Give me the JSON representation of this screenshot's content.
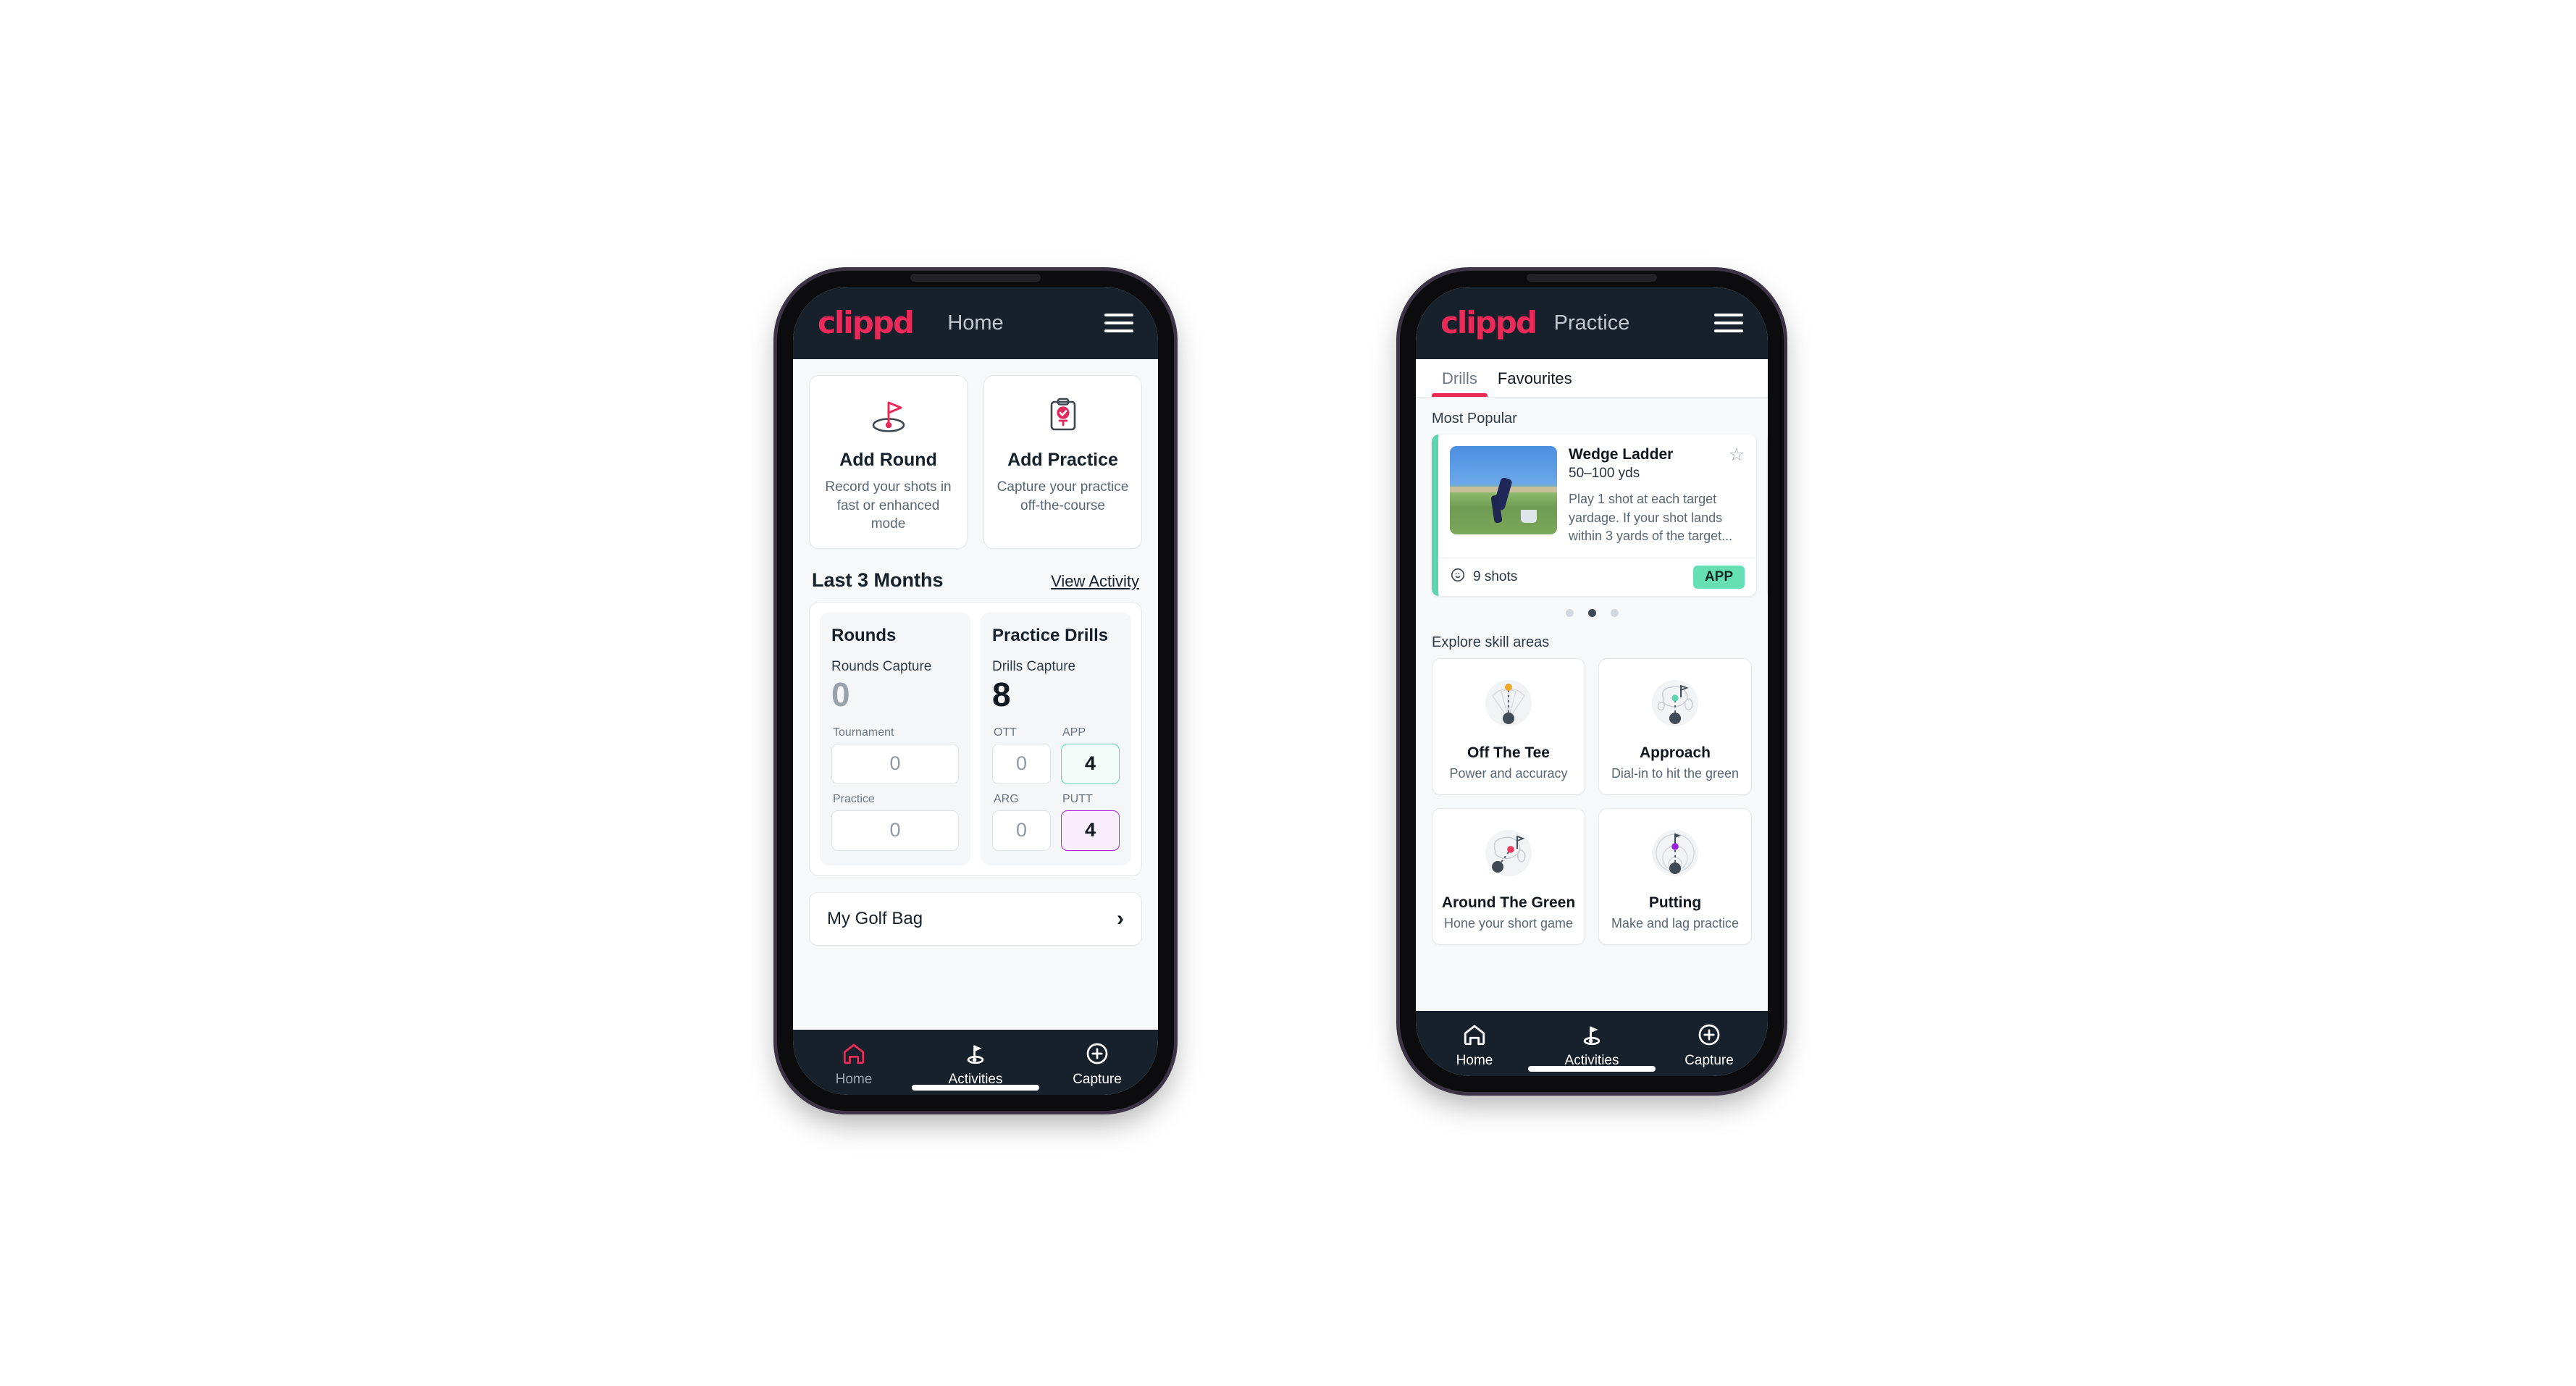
{
  "phone_home": {
    "appbar": {
      "logo": "clippd",
      "title": "Home",
      "menu_icon": "hamburger-menu-icon"
    },
    "actions": [
      {
        "icon": "golf-flag-icon",
        "title": "Add Round",
        "subtitle": "Record your shots in fast or enhanced mode"
      },
      {
        "icon": "clipboard-check-icon",
        "title": "Add Practice",
        "subtitle": "Capture your practice off-the-course"
      }
    ],
    "section": {
      "title": "Last 3 Months",
      "link": "View Activity"
    },
    "rounds": {
      "heading": "Rounds",
      "capture_label": "Rounds Capture",
      "capture_value": "0",
      "items": [
        {
          "label": "Tournament",
          "value": "0"
        },
        {
          "label": "Practice",
          "value": "0"
        }
      ]
    },
    "drills": {
      "heading": "Practice Drills",
      "capture_label": "Drills Capture",
      "capture_value": "8",
      "items": [
        {
          "label": "OTT",
          "value": "0",
          "style": "plain"
        },
        {
          "label": "APP",
          "value": "4",
          "style": "app"
        },
        {
          "label": "ARG",
          "value": "0",
          "style": "plain"
        },
        {
          "label": "PUTT",
          "value": "4",
          "style": "putt"
        }
      ]
    },
    "golf_bag": {
      "label": "My Golf Bag",
      "chevron": "chevron-right-icon"
    },
    "bottom_nav": [
      {
        "icon": "home-icon",
        "label": "Home",
        "state": "active-pink"
      },
      {
        "icon": "golf-flag-nav-icon",
        "label": "Activities",
        "state": "active-white"
      },
      {
        "icon": "plus-circle-icon",
        "label": "Capture",
        "state": "active-white"
      }
    ]
  },
  "phone_practice": {
    "appbar": {
      "logo": "clippd",
      "title": "Practice",
      "menu_icon": "hamburger-menu-icon"
    },
    "tabs": [
      {
        "label": "Drills",
        "selected": true
      },
      {
        "label": "Favourites",
        "selected": false
      }
    ],
    "most_popular_label": "Most Popular",
    "drill": {
      "thumbnail": "golfer-wedge-photo",
      "name": "Wedge Ladder",
      "yardage": "50–100 yds",
      "description": "Play 1 shot at each target yardage. If your shot lands within 3 yards of the target...",
      "star_icon": "star-outline-icon",
      "shots_icon": "golf-ball-icon",
      "shots": "9 shots",
      "badge": "APP",
      "accent_color": "#5fd4b0",
      "next_accent_color": "#9b1fe0"
    },
    "carousel_dots": {
      "count": 3,
      "active_index": 1
    },
    "explore_label": "Explore skill areas",
    "skills": [
      {
        "icon": "off-the-tee-icon",
        "title": "Off The Tee",
        "subtitle": "Power and accuracy",
        "dot_color": "#f0a82a"
      },
      {
        "icon": "approach-icon",
        "title": "Approach",
        "subtitle": "Dial-in to hit the green",
        "dot_color": "#5fd4b0"
      },
      {
        "icon": "around-the-green-icon",
        "title": "Around The Green",
        "subtitle": "Hone your short game",
        "dot_color": "#ec3b5e"
      },
      {
        "icon": "putting-icon",
        "title": "Putting",
        "subtitle": "Make and lag practice",
        "dot_color": "#9b1fe0"
      }
    ],
    "bottom_nav": [
      {
        "icon": "home-icon",
        "label": "Home",
        "state": "inactive"
      },
      {
        "icon": "golf-flag-nav-icon",
        "label": "Activities",
        "state": "active-white"
      },
      {
        "icon": "plus-circle-icon",
        "label": "Capture",
        "state": "active-white"
      }
    ]
  },
  "colors": {
    "brand_pink": "#ec2a5a",
    "appbar_dark": "#16212b",
    "teal": "#5fd4b0",
    "purple": "#9b1fe0",
    "page_bg": "#f7f8fa"
  }
}
